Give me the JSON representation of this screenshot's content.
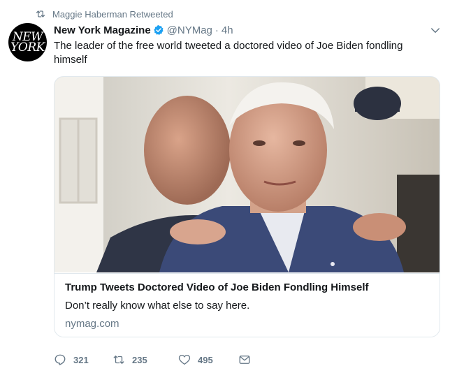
{
  "social_context": {
    "text": "Maggie Haberman Retweeted",
    "icon": "retweet-icon"
  },
  "author": {
    "avatar_text_line1": "NEW",
    "avatar_text_line2": "YORK",
    "name": "New York Magazine",
    "verified": true,
    "handle": "@NYMag",
    "separator": "·",
    "time": "4h"
  },
  "tweet": {
    "text": "The leader of the free world tweeted a doctored video of Joe Biden fondling himself"
  },
  "card": {
    "title": "Trump Tweets Doctored Video of Joe Biden Fondling Himself",
    "description": "Don’t really know what else to say here.",
    "domain": "nymag.com"
  },
  "actions": {
    "replies": "321",
    "retweets": "235",
    "likes": "495"
  },
  "colors": {
    "accent": "#1da1f2",
    "secondary_text": "#657786",
    "primary_text": "#14171a",
    "border": "#e1e8ed"
  }
}
